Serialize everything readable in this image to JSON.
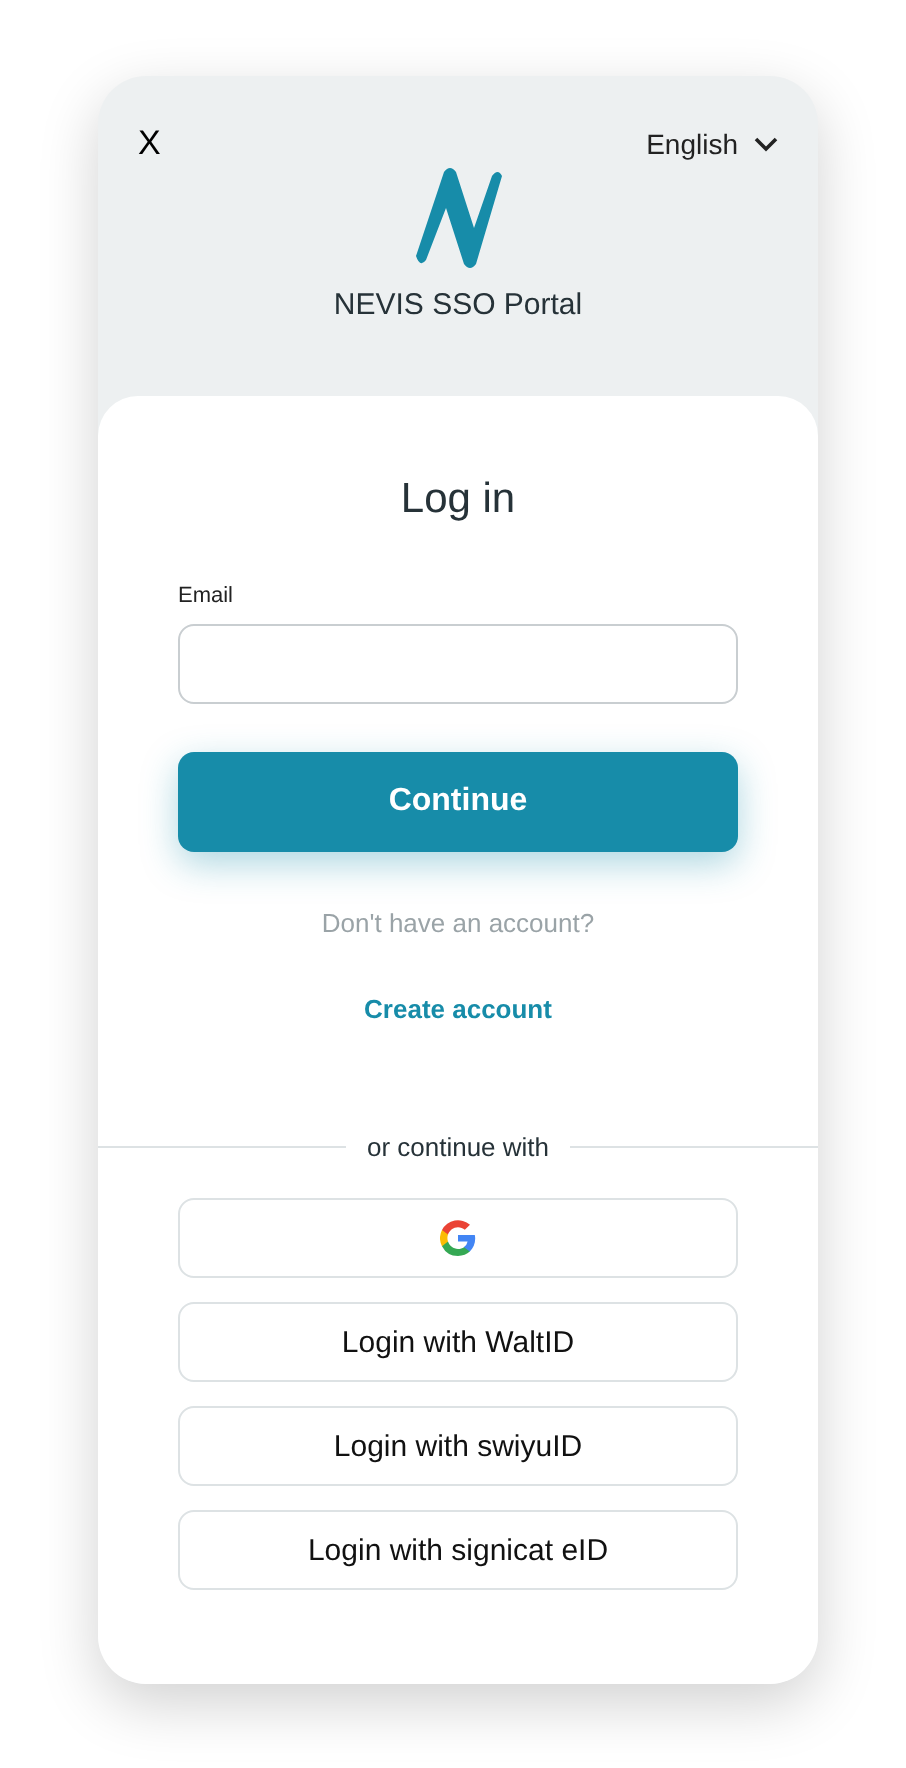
{
  "header": {
    "close": "X",
    "language": "English",
    "portal_name": "NEVIS SSO Portal"
  },
  "login": {
    "title": "Log in",
    "email_label": "Email",
    "continue": "Continue",
    "no_account": "Don't have an account?",
    "create_account": "Create account"
  },
  "divider": "or continue with",
  "providers": [
    {
      "kind": "icon"
    },
    {
      "kind": "text",
      "label": "Login with WaltID"
    },
    {
      "kind": "text",
      "label": "Login with swiyuID"
    },
    {
      "kind": "text",
      "label": "Login with signicat eID"
    }
  ]
}
